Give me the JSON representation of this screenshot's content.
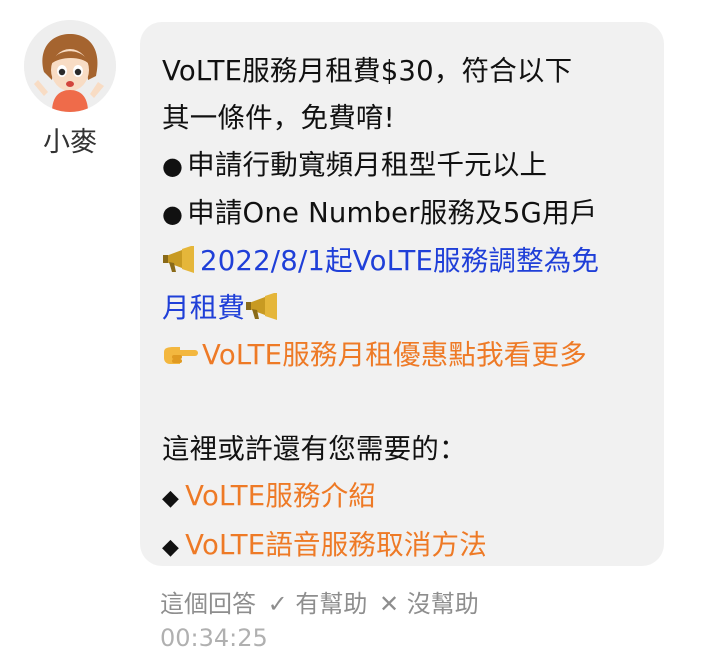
{
  "bot": {
    "name": "小麥",
    "avatar_icon": "cartoon-girl-avatar-icon"
  },
  "message": {
    "intro_line1": "VoLTE服務月租費$30，符合以下",
    "intro_line2": "其一條件，免費唷!",
    "condition1": "申請行動寬頻月租型千元以上",
    "condition2": "申請One Number服務及5G用戶",
    "bullet_char": "●",
    "announcement_line1": "2022/8/1起VoLTE服務調整為免",
    "announcement_line2": "月租費",
    "promo_link": "VoLTE服務月租優惠點我看更多",
    "suggestions_heading": "這裡或許還有您需要的：",
    "diamond_char": "◆",
    "suggestions": [
      "VoLTE服務介紹",
      "VoLTE語音服務取消方法"
    ]
  },
  "feedback": {
    "question": "這個回答",
    "helpful": "✓ 有幫助",
    "not_helpful": "✕ 沒幫助"
  },
  "timestamp": "00:34:25",
  "colors": {
    "bubble_bg": "#f1f1f1",
    "link_blue": "#1f3fd8",
    "link_orange": "#ee7a26",
    "muted_text": "#8e8e8e"
  }
}
